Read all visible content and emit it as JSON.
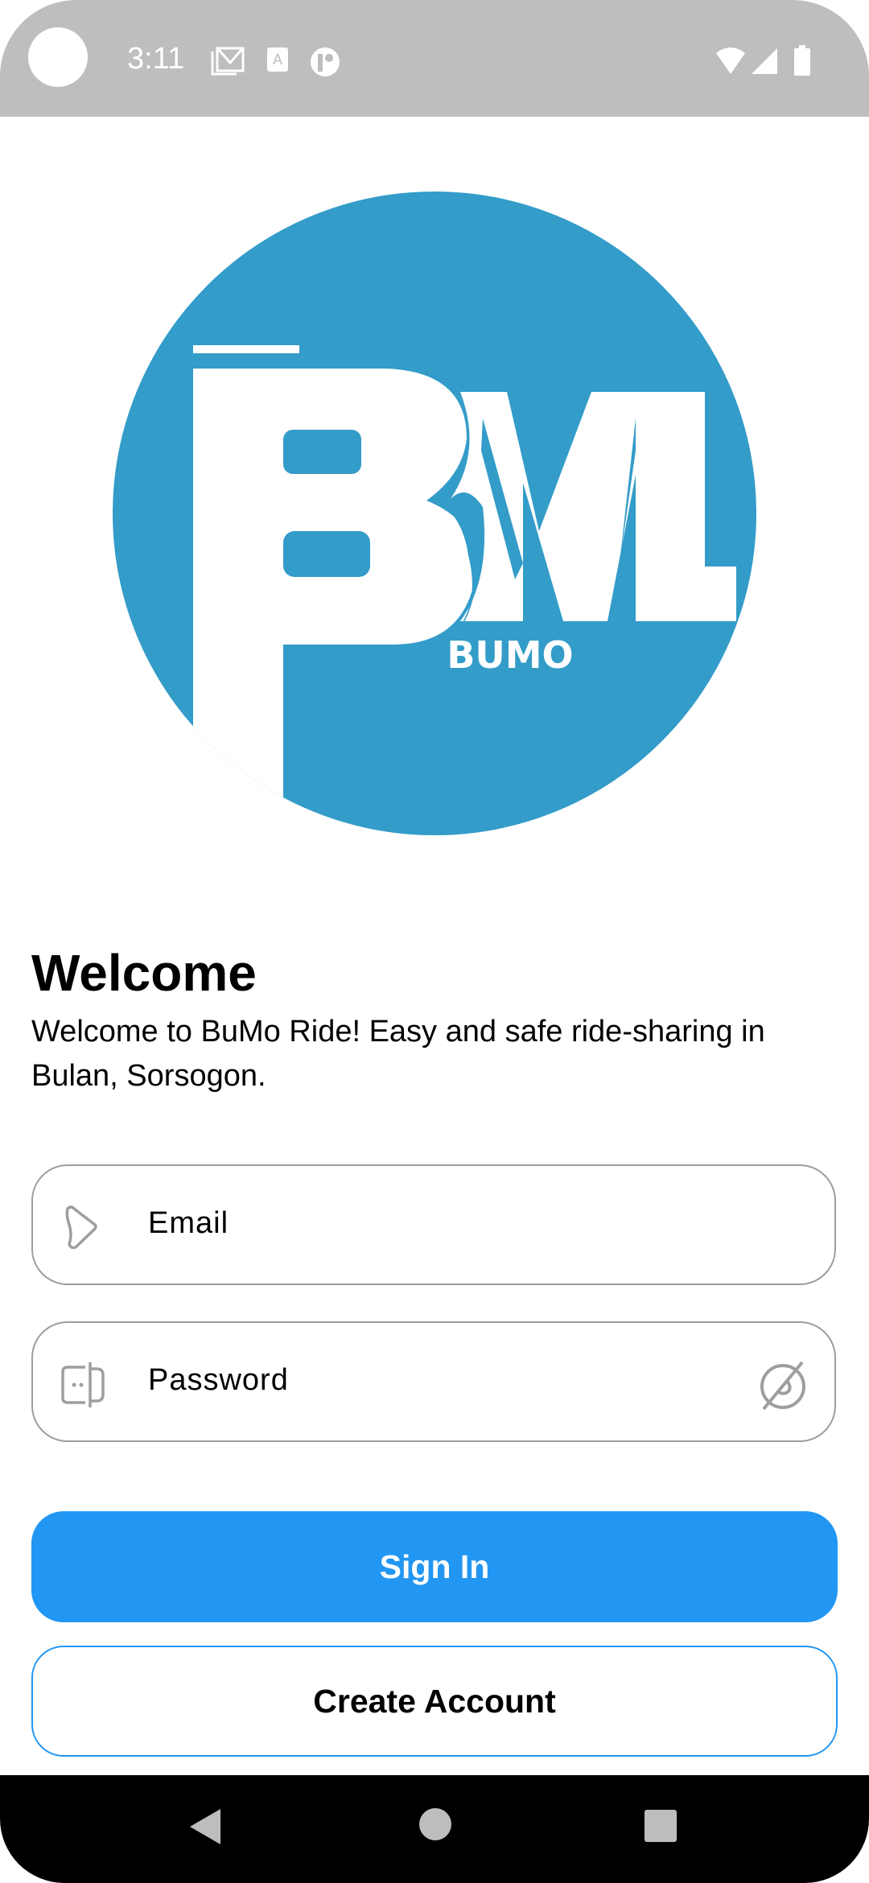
{
  "status_bar": {
    "time": "3:11",
    "notification_icons": [
      "gmail-icon",
      "translate-icon",
      "app-icon"
    ],
    "system_icons": [
      "wifi-icon",
      "signal-icon",
      "battery-icon"
    ]
  },
  "logo": {
    "text": "BUMO",
    "color": "#339cc9"
  },
  "welcome": {
    "title": "Welcome",
    "subtitle": "Welcome to BuMo Ride! Easy and safe ride-sharing in Bulan, Sorsogon."
  },
  "form": {
    "email_placeholder": "Email",
    "password_placeholder": "Password"
  },
  "buttons": {
    "sign_in": "Sign In",
    "create_account": "Create Account"
  },
  "colors": {
    "primary": "#2196f3",
    "field_border": "#9e9e9e"
  }
}
